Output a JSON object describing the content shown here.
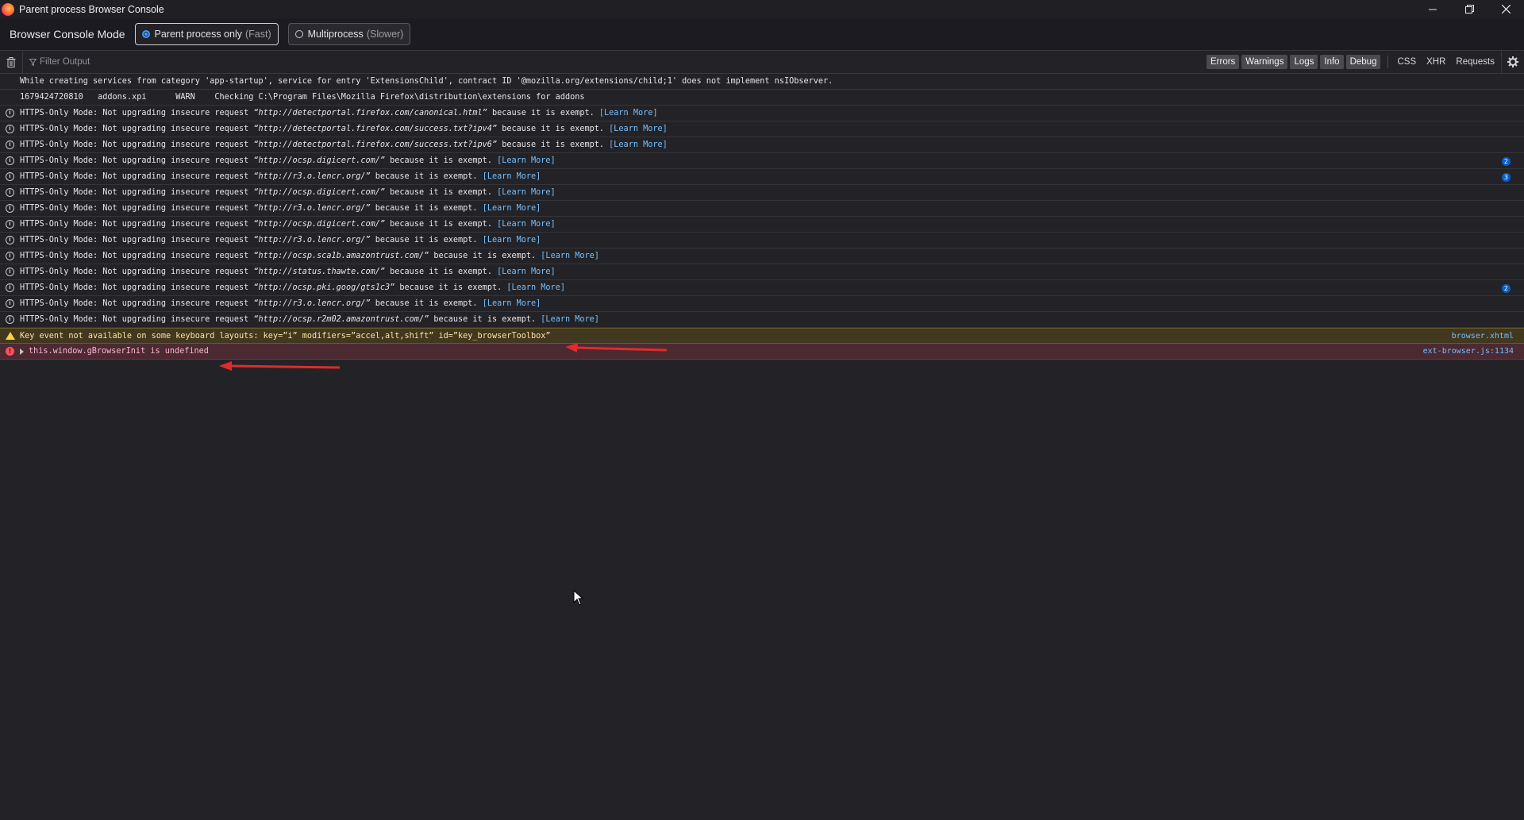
{
  "window": {
    "title": "Parent process Browser Console",
    "controls": [
      "minimize-icon",
      "restore-icon",
      "close-icon"
    ]
  },
  "mode_bar": {
    "label": "Browser Console Mode",
    "options": [
      {
        "label": "Parent process only",
        "hint": "(Fast)",
        "selected": true
      },
      {
        "label": "Multiprocess",
        "hint": "(Slower)",
        "selected": false
      }
    ]
  },
  "toolbar": {
    "filter_placeholder": "Filter Output",
    "levels": [
      {
        "label": "Errors",
        "active": true
      },
      {
        "label": "Warnings",
        "active": true
      },
      {
        "label": "Logs",
        "active": true
      },
      {
        "label": "Info",
        "active": true
      },
      {
        "label": "Debug",
        "active": true
      }
    ],
    "extras": [
      "CSS",
      "XHR",
      "Requests"
    ]
  },
  "messages": [
    {
      "type": "plain",
      "text": "While creating services from category 'app-startup', service for entry 'ExtensionsChild', contract ID '@mozilla.org/extensions/child;1' does not implement nsIObserver."
    },
    {
      "type": "plain",
      "text": "1679424720810\taddons.xpi\tWARN\tChecking C:\\Program Files\\Mozilla Firefox\\distribution\\extensions for addons"
    },
    {
      "type": "info",
      "pre": "HTTPS-Only Mode: Not upgrading insecure request ",
      "url": "“http://detectportal.firefox.com/canonical.html”",
      "post": " because it is exempt. ",
      "link": "[Learn More]"
    },
    {
      "type": "info",
      "pre": "HTTPS-Only Mode: Not upgrading insecure request ",
      "url": "“http://detectportal.firefox.com/success.txt?ipv4”",
      "post": " because it is exempt. ",
      "link": "[Learn More]"
    },
    {
      "type": "info",
      "pre": "HTTPS-Only Mode: Not upgrading insecure request ",
      "url": "“http://detectportal.firefox.com/success.txt?ipv6”",
      "post": " because it is exempt. ",
      "link": "[Learn More]"
    },
    {
      "type": "info",
      "pre": "HTTPS-Only Mode: Not upgrading insecure request ",
      "url": "“http://ocsp.digicert.com/”",
      "post": " because it is exempt. ",
      "link": "[Learn More]",
      "count": "2"
    },
    {
      "type": "info",
      "pre": "HTTPS-Only Mode: Not upgrading insecure request ",
      "url": "“http://r3.o.lencr.org/”",
      "post": " because it is exempt. ",
      "link": "[Learn More]",
      "count": "3"
    },
    {
      "type": "info",
      "pre": "HTTPS-Only Mode: Not upgrading insecure request ",
      "url": "“http://ocsp.digicert.com/”",
      "post": " because it is exempt. ",
      "link": "[Learn More]"
    },
    {
      "type": "info",
      "pre": "HTTPS-Only Mode: Not upgrading insecure request ",
      "url": "“http://r3.o.lencr.org/”",
      "post": " because it is exempt. ",
      "link": "[Learn More]"
    },
    {
      "type": "info",
      "pre": "HTTPS-Only Mode: Not upgrading insecure request ",
      "url": "“http://ocsp.digicert.com/”",
      "post": " because it is exempt. ",
      "link": "[Learn More]"
    },
    {
      "type": "info",
      "pre": "HTTPS-Only Mode: Not upgrading insecure request ",
      "url": "“http://r3.o.lencr.org/”",
      "post": " because it is exempt. ",
      "link": "[Learn More]"
    },
    {
      "type": "info",
      "pre": "HTTPS-Only Mode: Not upgrading insecure request ",
      "url": "“http://ocsp.sca1b.amazontrust.com/”",
      "post": " because it is exempt. ",
      "link": "[Learn More]"
    },
    {
      "type": "info",
      "pre": "HTTPS-Only Mode: Not upgrading insecure request ",
      "url": "“http://status.thawte.com/”",
      "post": " because it is exempt. ",
      "link": "[Learn More]"
    },
    {
      "type": "info",
      "pre": "HTTPS-Only Mode: Not upgrading insecure request ",
      "url": "“http://ocsp.pki.goog/gts1c3”",
      "post": " because it is exempt. ",
      "link": "[Learn More]",
      "count": "2"
    },
    {
      "type": "info",
      "pre": "HTTPS-Only Mode: Not upgrading insecure request ",
      "url": "“http://r3.o.lencr.org/”",
      "post": " because it is exempt. ",
      "link": "[Learn More]"
    },
    {
      "type": "info",
      "pre": "HTTPS-Only Mode: Not upgrading insecure request ",
      "url": "“http://ocsp.r2m02.amazontrust.com/”",
      "post": " because it is exempt. ",
      "link": "[Learn More]"
    }
  ],
  "warning": {
    "text": "Key event not available on some keyboard layouts: key=”i” modifiers=”accel,alt,shift” id=”key_browserToolbox”",
    "source": "browser.xhtml",
    "annotation_color": "#e02b2b"
  },
  "error": {
    "text": "this.window.gBrowserInit is undefined",
    "source": "ext-browser.js:1134",
    "annotation_color": "#e02b2b"
  }
}
